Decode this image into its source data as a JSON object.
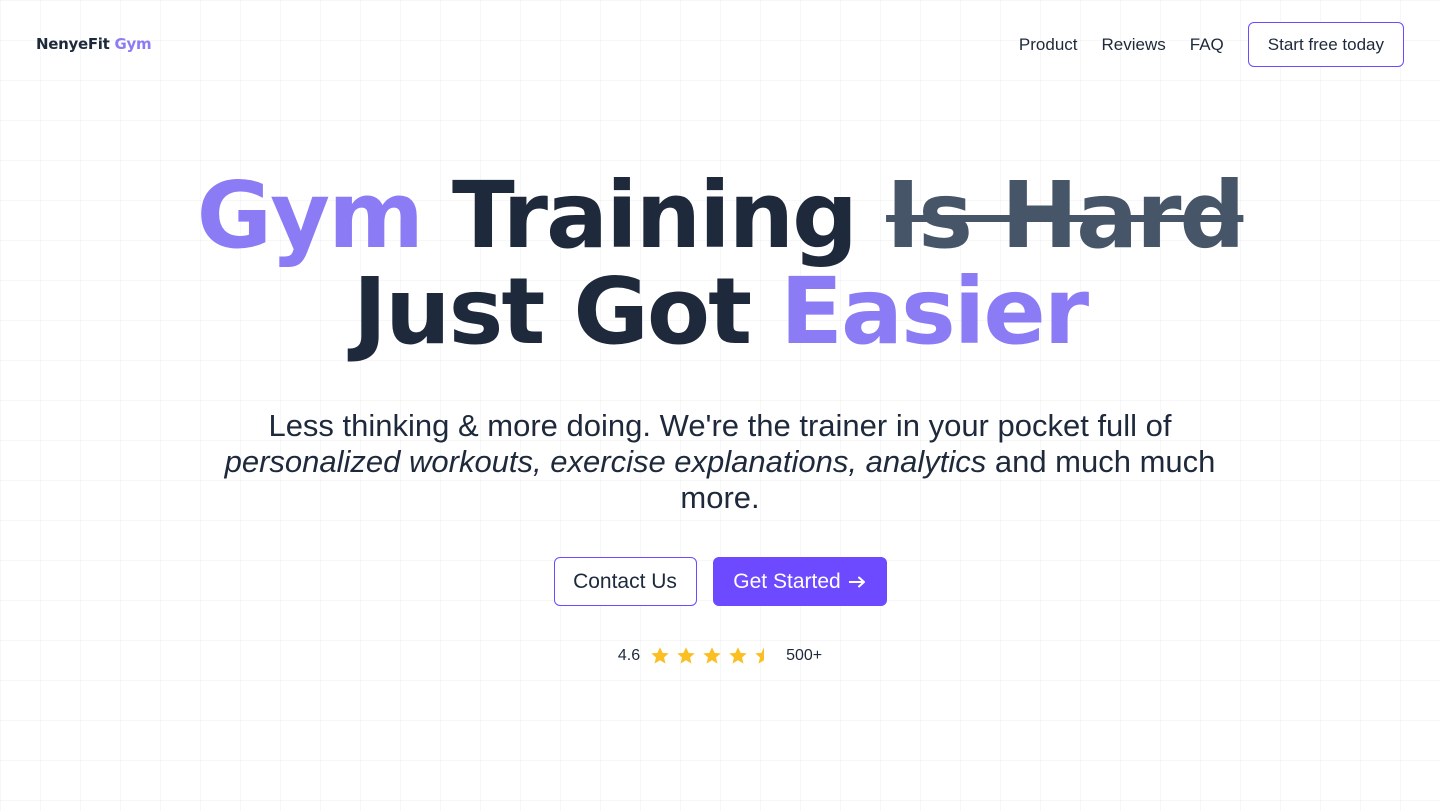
{
  "nav": {
    "logo_main": "NenyeFit",
    "logo_accent": "Gym",
    "links": [
      "Product",
      "Reviews",
      "FAQ"
    ],
    "cta_label": "Start free today"
  },
  "hero": {
    "title_word1": "Gym",
    "title_word2": "Training",
    "title_struck": "Is Hard",
    "title_line2": "Just Got",
    "title_accent": "Easier",
    "subtitle_plain1": "Less thinking & more doing. We're the trainer in your pocket full of",
    "subtitle_italic": "personalized workouts, exercise explanations, analytics",
    "subtitle_plain2": "and much much more."
  },
  "buttons": {
    "contact_label": "Contact Us",
    "start_label": "Get Started",
    "start_icon": "arrow-right-icon"
  },
  "rating": {
    "score": "4.6",
    "stars_filled": 4.5,
    "stars_total": 5,
    "count": "500+",
    "star_color": "#fbbf24"
  },
  "colors": {
    "accent": "#6d4aff",
    "accent_light": "#8b7cf6",
    "text": "#1e293b",
    "strike": "#475569"
  }
}
